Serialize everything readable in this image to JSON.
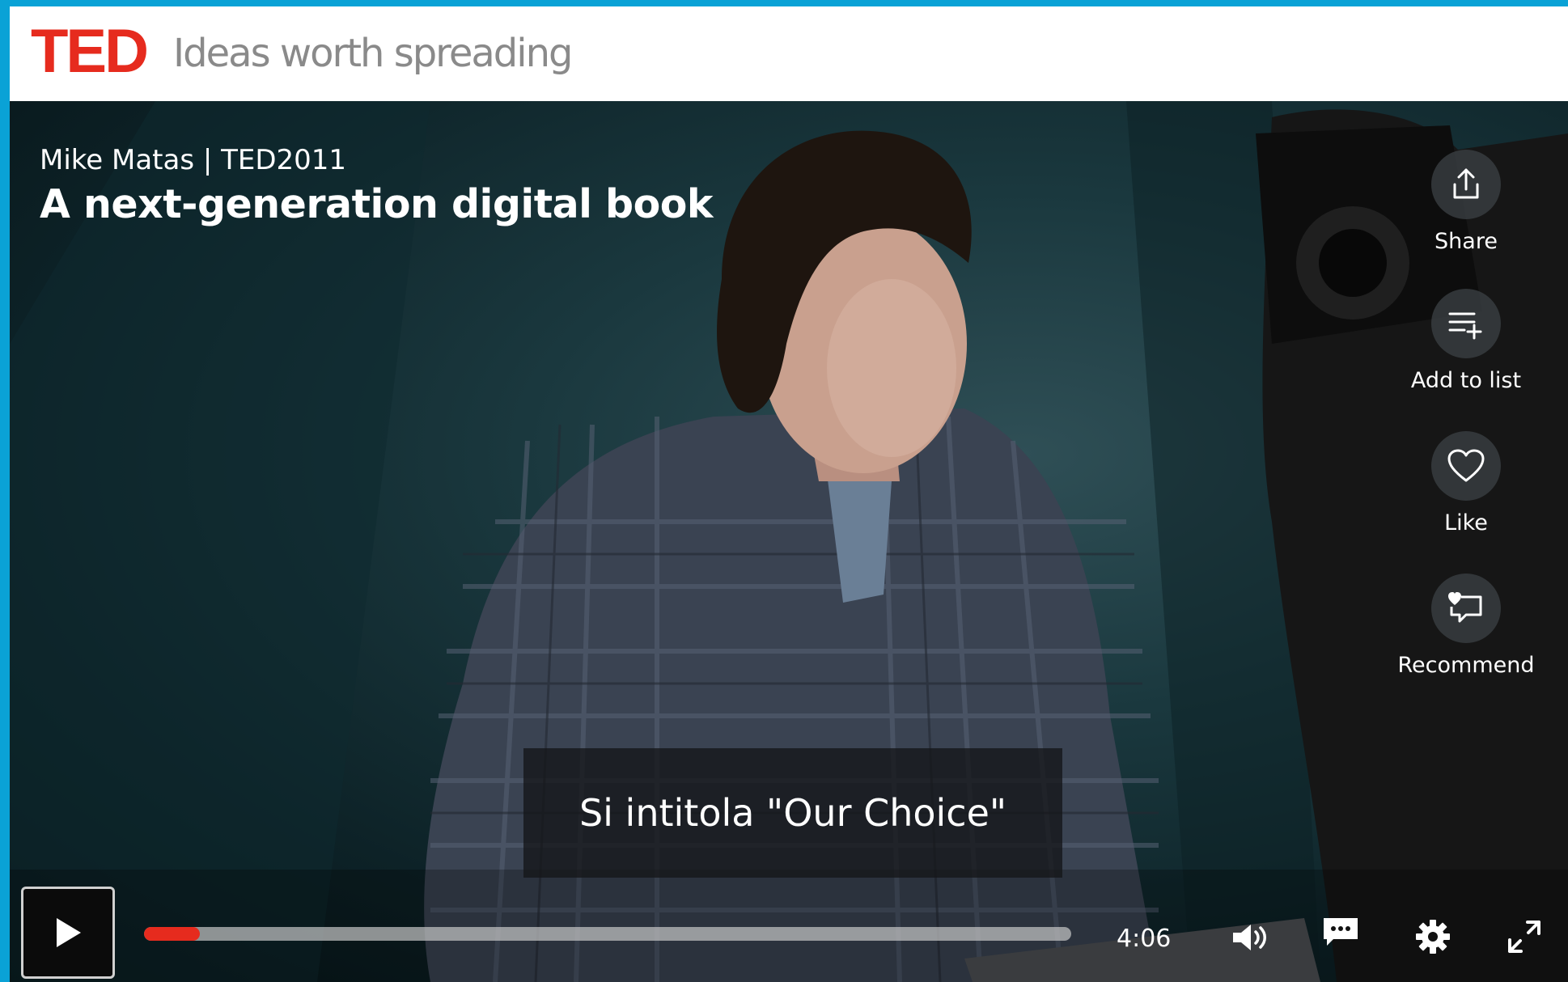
{
  "header": {
    "logo": "TED",
    "tagline": "Ideas worth spreading"
  },
  "talk": {
    "speaker_event": "Mike Matas | TED2011",
    "title": "A next-generation digital book"
  },
  "actions": [
    {
      "label": "Share",
      "icon": "share-icon"
    },
    {
      "label": "Add to list",
      "icon": "add-to-list-icon"
    },
    {
      "label": "Like",
      "icon": "heart-icon"
    },
    {
      "label": "Recommend",
      "icon": "recommend-icon"
    }
  ],
  "subtitle": "Si intitola \"Our Choice\"",
  "player": {
    "time": "4:06",
    "progress_fraction": 0.06,
    "state": "paused",
    "icons": [
      "play-icon",
      "volume-icon",
      "captions-icon",
      "settings-icon",
      "fullscreen-icon"
    ]
  },
  "colors": {
    "brand_red": "#e62b1e",
    "frame_blue": "#0aa2d6"
  }
}
